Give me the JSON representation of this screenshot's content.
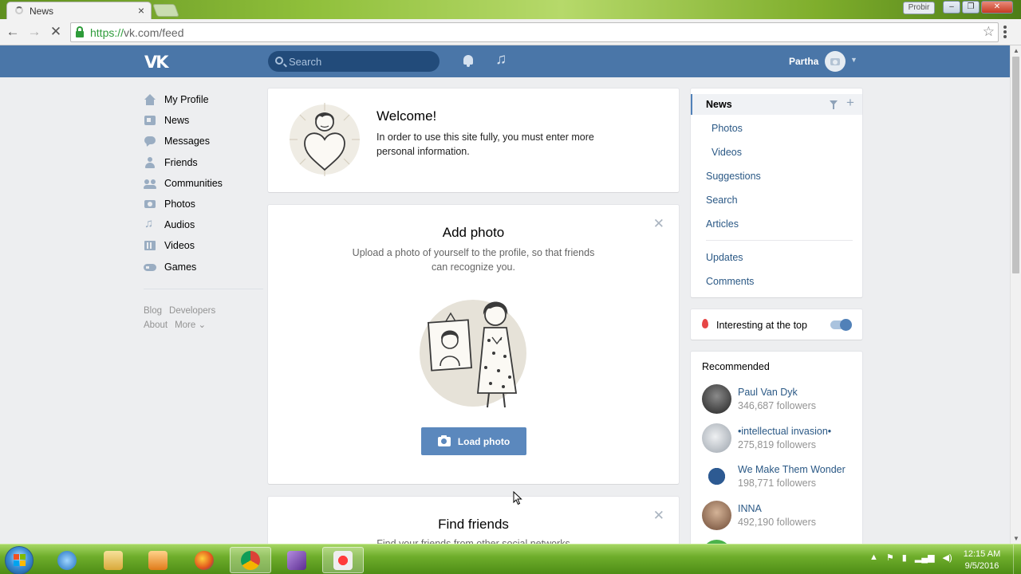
{
  "browser": {
    "tab_title": "News",
    "url_scheme": "https://",
    "url_rest": "vk.com/feed",
    "profile_label": "Probir"
  },
  "header": {
    "logo": "VK",
    "search_placeholder": "Search",
    "user_name": "Partha"
  },
  "leftnav": {
    "items": [
      {
        "label": "My Profile",
        "icon": "home-icon"
      },
      {
        "label": "News",
        "icon": "news-icon"
      },
      {
        "label": "Messages",
        "icon": "messages-icon"
      },
      {
        "label": "Friends",
        "icon": "friends-icon"
      },
      {
        "label": "Communities",
        "icon": "communities-icon"
      },
      {
        "label": "Photos",
        "icon": "photos-icon"
      },
      {
        "label": "Audios",
        "icon": "audios-icon"
      },
      {
        "label": "Videos",
        "icon": "videos-icon"
      },
      {
        "label": "Games",
        "icon": "games-icon"
      }
    ],
    "footer": {
      "blog": "Blog",
      "developers": "Developers",
      "about": "About",
      "more": "More ⌄"
    }
  },
  "welcome": {
    "title": "Welcome!",
    "text": "In order to use this site fully, you must enter more personal information."
  },
  "add_photo": {
    "title": "Add photo",
    "text": "Upload a photo of yourself to the profile, so that friends can recognize you.",
    "button": "Load photo"
  },
  "find_friends": {
    "title": "Find friends",
    "text": "Find your friends from other social networks"
  },
  "right_menu": {
    "active": "News",
    "items": [
      "Photos",
      "Videos",
      "Suggestions",
      "Search",
      "Articles"
    ],
    "items2": [
      "Updates",
      "Comments"
    ]
  },
  "toggle": {
    "label": "Interesting at the top",
    "on": true
  },
  "recommended": {
    "title": "Recommended",
    "items": [
      {
        "name": "Paul Van Dyk",
        "followers": "346,687 followers",
        "color": "#3b3b3b"
      },
      {
        "name": "•intellectual invasion•",
        "followers": "275,819 followers",
        "color": "#bfc5cc"
      },
      {
        "name": "We Make Them Wonder",
        "followers": "198,771 followers",
        "color": "#1f3f6e"
      },
      {
        "name": "INNA",
        "followers": "492,190 followers",
        "color": "#a07a5e"
      }
    ]
  },
  "taskbar": {
    "time": "12:15 AM",
    "date": "9/5/2016"
  }
}
